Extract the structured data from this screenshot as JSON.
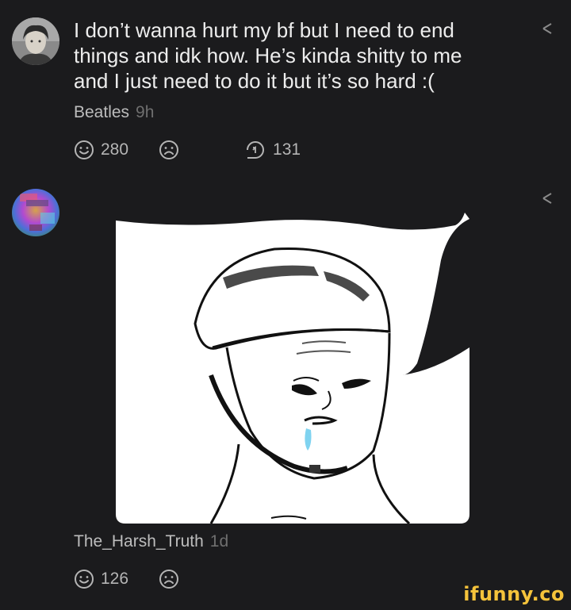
{
  "comments": [
    {
      "username": "Beatles",
      "time": "9h",
      "text": "I don’t wanna hurt my bf but I need to end things and idk how. He’s kinda shitty to me and I just need to do it but it’s so hard :(",
      "likes": "280",
      "replies": "131",
      "avatar_icon": "portrait-photo"
    },
    {
      "username": "The_Harsh_Truth",
      "time": "1d",
      "likes": "126",
      "avatar_icon": "colorful-portrait",
      "attachment_icon": "helmet-wojak-meme"
    }
  ],
  "watermark": "ifunny.co",
  "colors": {
    "background": "#1b1b1d",
    "text": "#ededed",
    "muted": "#6f6f6f",
    "brand": "#f5c33b"
  }
}
